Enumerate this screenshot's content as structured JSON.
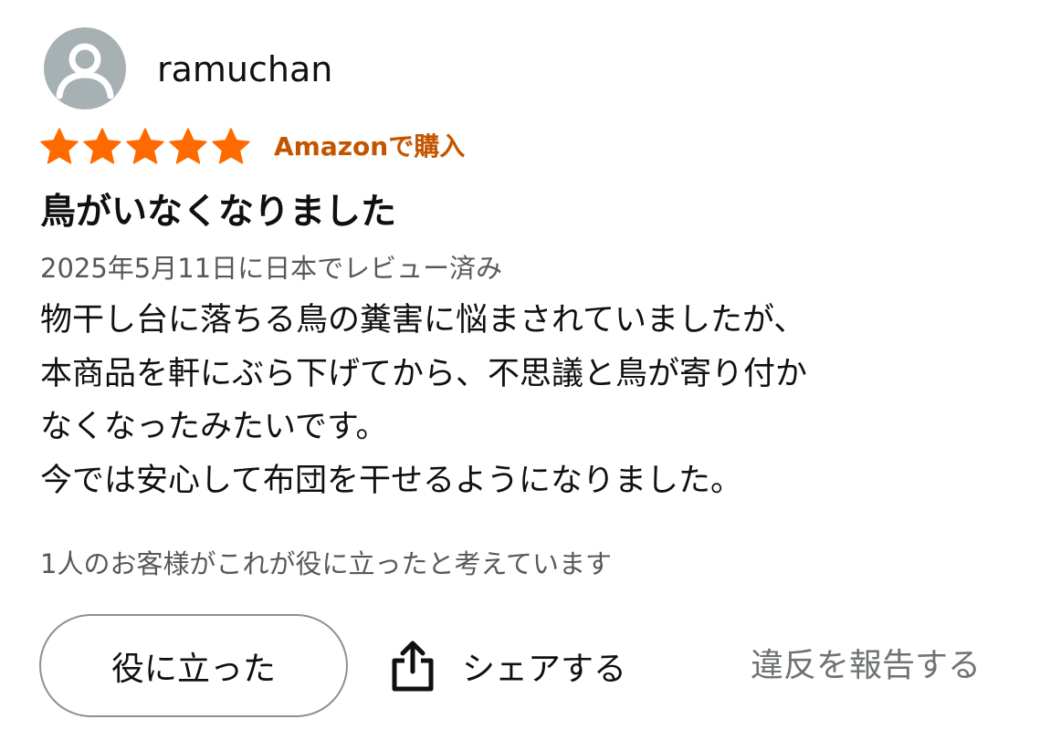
{
  "review": {
    "username": "ramuchan",
    "avatar_icon": "user-silhouette-icon",
    "rating": 5,
    "rating_max": 5,
    "star_color": "#ff6a00",
    "purchase_badge": "Amazonで購入",
    "purchase_badge_color": "#c45500",
    "title": "鳥がいなくなりました",
    "date": "2025年5月11日に日本でレビュー済み",
    "body_lines": [
      "物干し台に落ちる鳥の糞害に悩まされていましたが、",
      "本商品を軒にぶら下げてから、不思議と鳥が寄り付か",
      "なくなったみたいです。",
      "今では安心して布団を干せるようになりました。"
    ],
    "helpful_count_text": "1人のお客様がこれが役に立ったと考えています"
  },
  "actions": {
    "helpful_label": "役に立った",
    "share_icon": "share-icon",
    "share_label": "シェアする",
    "report_label": "違反を報告する"
  }
}
